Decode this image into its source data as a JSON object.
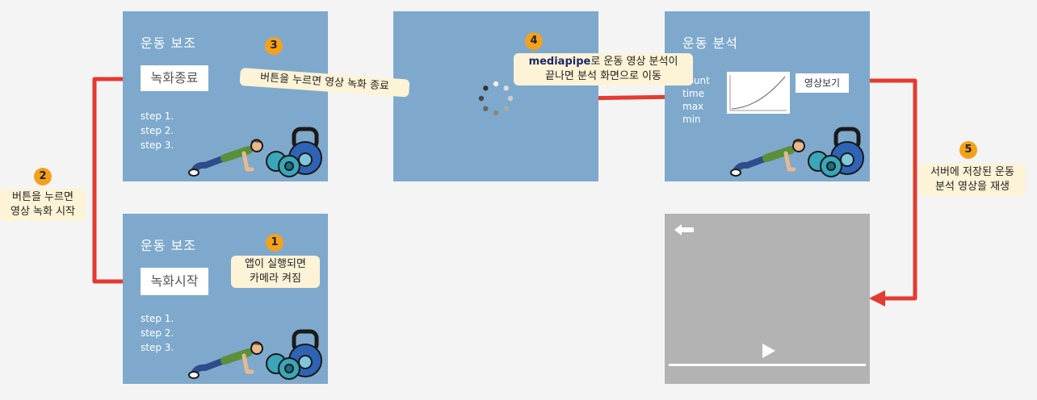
{
  "panel_assist": {
    "title": "운동 보조",
    "record_start_label": "녹화시작",
    "record_stop_label": "녹화종료",
    "steps": [
      "step 1.",
      "step 2.",
      "step 3."
    ]
  },
  "panel_analysis": {
    "title": "운동 분석",
    "stats": [
      "count",
      "time",
      "max",
      "min"
    ],
    "watch_video_label": "영상보기"
  },
  "callouts": [
    {
      "number": "1",
      "lines": [
        "앱이 실행되면",
        "카메라 켜짐"
      ]
    },
    {
      "number": "2",
      "lines": [
        "버튼을 누르면",
        "영상 녹화 시작"
      ]
    },
    {
      "number": "3",
      "lines": [
        "버튼을 누르면 영상 녹화 종료"
      ]
    },
    {
      "number": "4",
      "bold": "mediapipe",
      "lines": [
        "로 운동 영상 분석이",
        "끝나면 분석 화면으로 이동"
      ]
    },
    {
      "number": "5",
      "lines": [
        "서버에 저장된 운동",
        "분석 영상을 재생"
      ]
    }
  ],
  "icons": {
    "back": "back-arrow-icon",
    "play": "play-icon",
    "spinner": "loading-spinner-icon",
    "pushup": "pushup-person-icon",
    "weights": "dumbbell-kettlebell-icon"
  },
  "colors": {
    "panel": "#7ea9cc",
    "arrow": "#e53a2f",
    "callout": "#fdf3d6",
    "badge": "#f3a11c",
    "video": "#b3b3b3"
  }
}
